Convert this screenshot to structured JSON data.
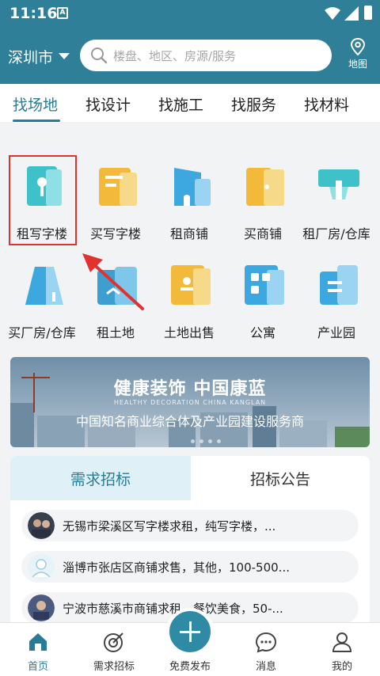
{
  "statusbar": {
    "time": "11:16",
    "notif": "A"
  },
  "header": {
    "city": "深圳市",
    "search_placeholder": "楼盘、地区、房源/服务",
    "map_label": "地图"
  },
  "tabs": [
    {
      "label": "找场地",
      "active": true
    },
    {
      "label": "找设计",
      "active": false
    },
    {
      "label": "找施工",
      "active": false
    },
    {
      "label": "找服务",
      "active": false
    },
    {
      "label": "找材料",
      "active": false
    }
  ],
  "categories": [
    {
      "label": "租写字楼",
      "icon": "office-rent-icon"
    },
    {
      "label": "买写字楼",
      "icon": "office-buy-icon"
    },
    {
      "label": "租商铺",
      "icon": "shop-rent-icon"
    },
    {
      "label": "买商铺",
      "icon": "shop-buy-icon"
    },
    {
      "label": "租厂房/仓库",
      "icon": "factory-rent-icon"
    },
    {
      "label": "买厂房/仓库",
      "icon": "factory-buy-icon"
    },
    {
      "label": "租土地",
      "icon": "land-rent-icon"
    },
    {
      "label": "土地出售",
      "icon": "land-sale-icon"
    },
    {
      "label": "公寓",
      "icon": "apartment-icon"
    },
    {
      "label": "产业园",
      "icon": "industrial-park-icon"
    }
  ],
  "banner": {
    "title": "健康装饰 中国康蓝",
    "en": "HEALTHY DECORATION CHINA KANGLAN",
    "subtitle": "中国知名商业综合体及产业园建设服务商"
  },
  "bid_tabs": {
    "left": "需求招标",
    "right": "招标公告"
  },
  "requests": [
    "无锡市梁溪区写字楼求租，纯写字楼，...",
    "淄博市张店区商铺求售，其他，100-500...",
    "宁波市慈溪市商铺求租，餐饮美食，50-..."
  ],
  "bottom_nav": {
    "home": "首页",
    "bids": "需求招标",
    "publish": "免费发布",
    "messages": "消息",
    "mine": "我的"
  },
  "colors": {
    "brand": "#2f7f99",
    "accent": "#2a7c95",
    "highlight": "#e0332f"
  }
}
